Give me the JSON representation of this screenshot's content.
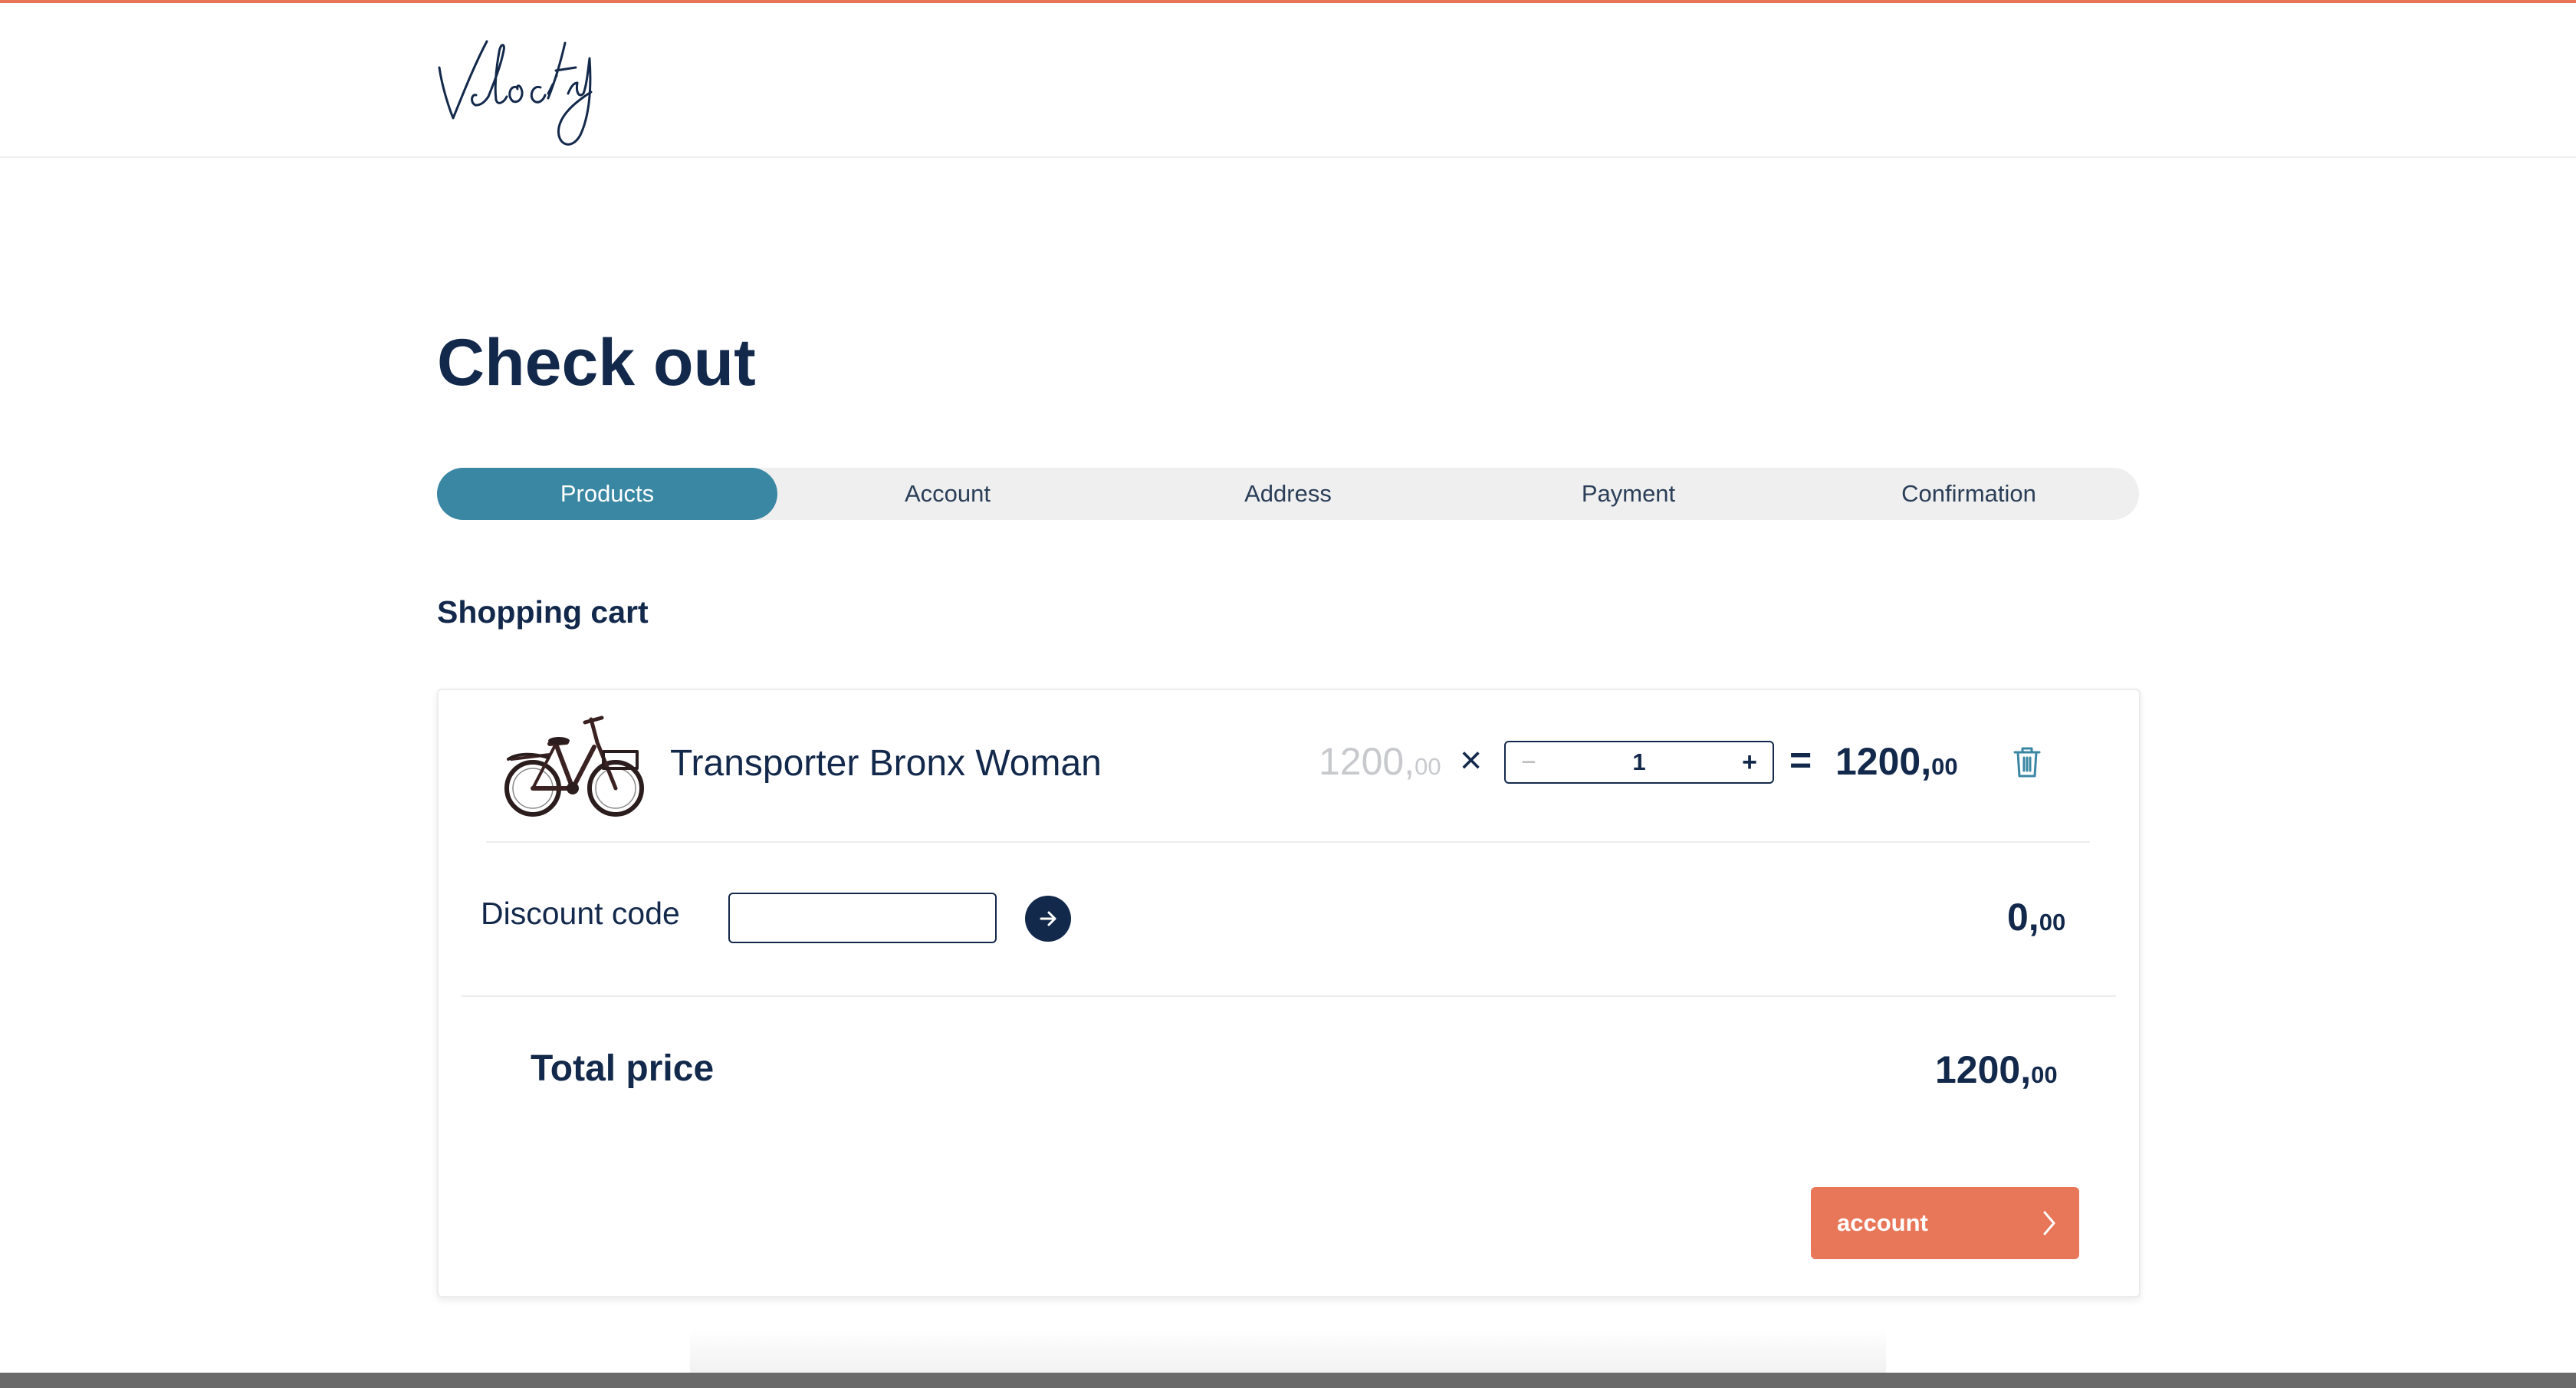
{
  "brand": {
    "logo_text": "Velocity",
    "accent_color": "#e8775a",
    "primary_color": "#13294b",
    "step_active_color": "#3a87a3"
  },
  "page": {
    "title": "Check out"
  },
  "steps": [
    {
      "label": "Products",
      "active": true
    },
    {
      "label": "Account",
      "active": false
    },
    {
      "label": "Address",
      "active": false
    },
    {
      "label": "Payment",
      "active": false
    },
    {
      "label": "Confirmation",
      "active": false
    }
  ],
  "cart": {
    "heading": "Shopping cart",
    "item": {
      "name": "Transporter Bronx Woman",
      "image_icon": "bicycle-image",
      "unit_price_int": "1200,",
      "unit_price_dec": "00",
      "times_sign": "×",
      "quantity": "1",
      "minus_label": "−",
      "plus_label": "+",
      "equals_sign": "=",
      "line_total_int": "1200,",
      "line_total_dec": "00",
      "delete_icon": "trash-icon"
    },
    "discount": {
      "label": "Discount code",
      "input_value": "",
      "input_placeholder": "",
      "apply_icon": "arrow-right-icon",
      "amount_int": "0,",
      "amount_dec": "00"
    },
    "total": {
      "label": "Total price",
      "amount_int": "1200,",
      "amount_dec": "00"
    },
    "next_button": {
      "label": "account",
      "icon": "chevron-right-icon"
    }
  }
}
